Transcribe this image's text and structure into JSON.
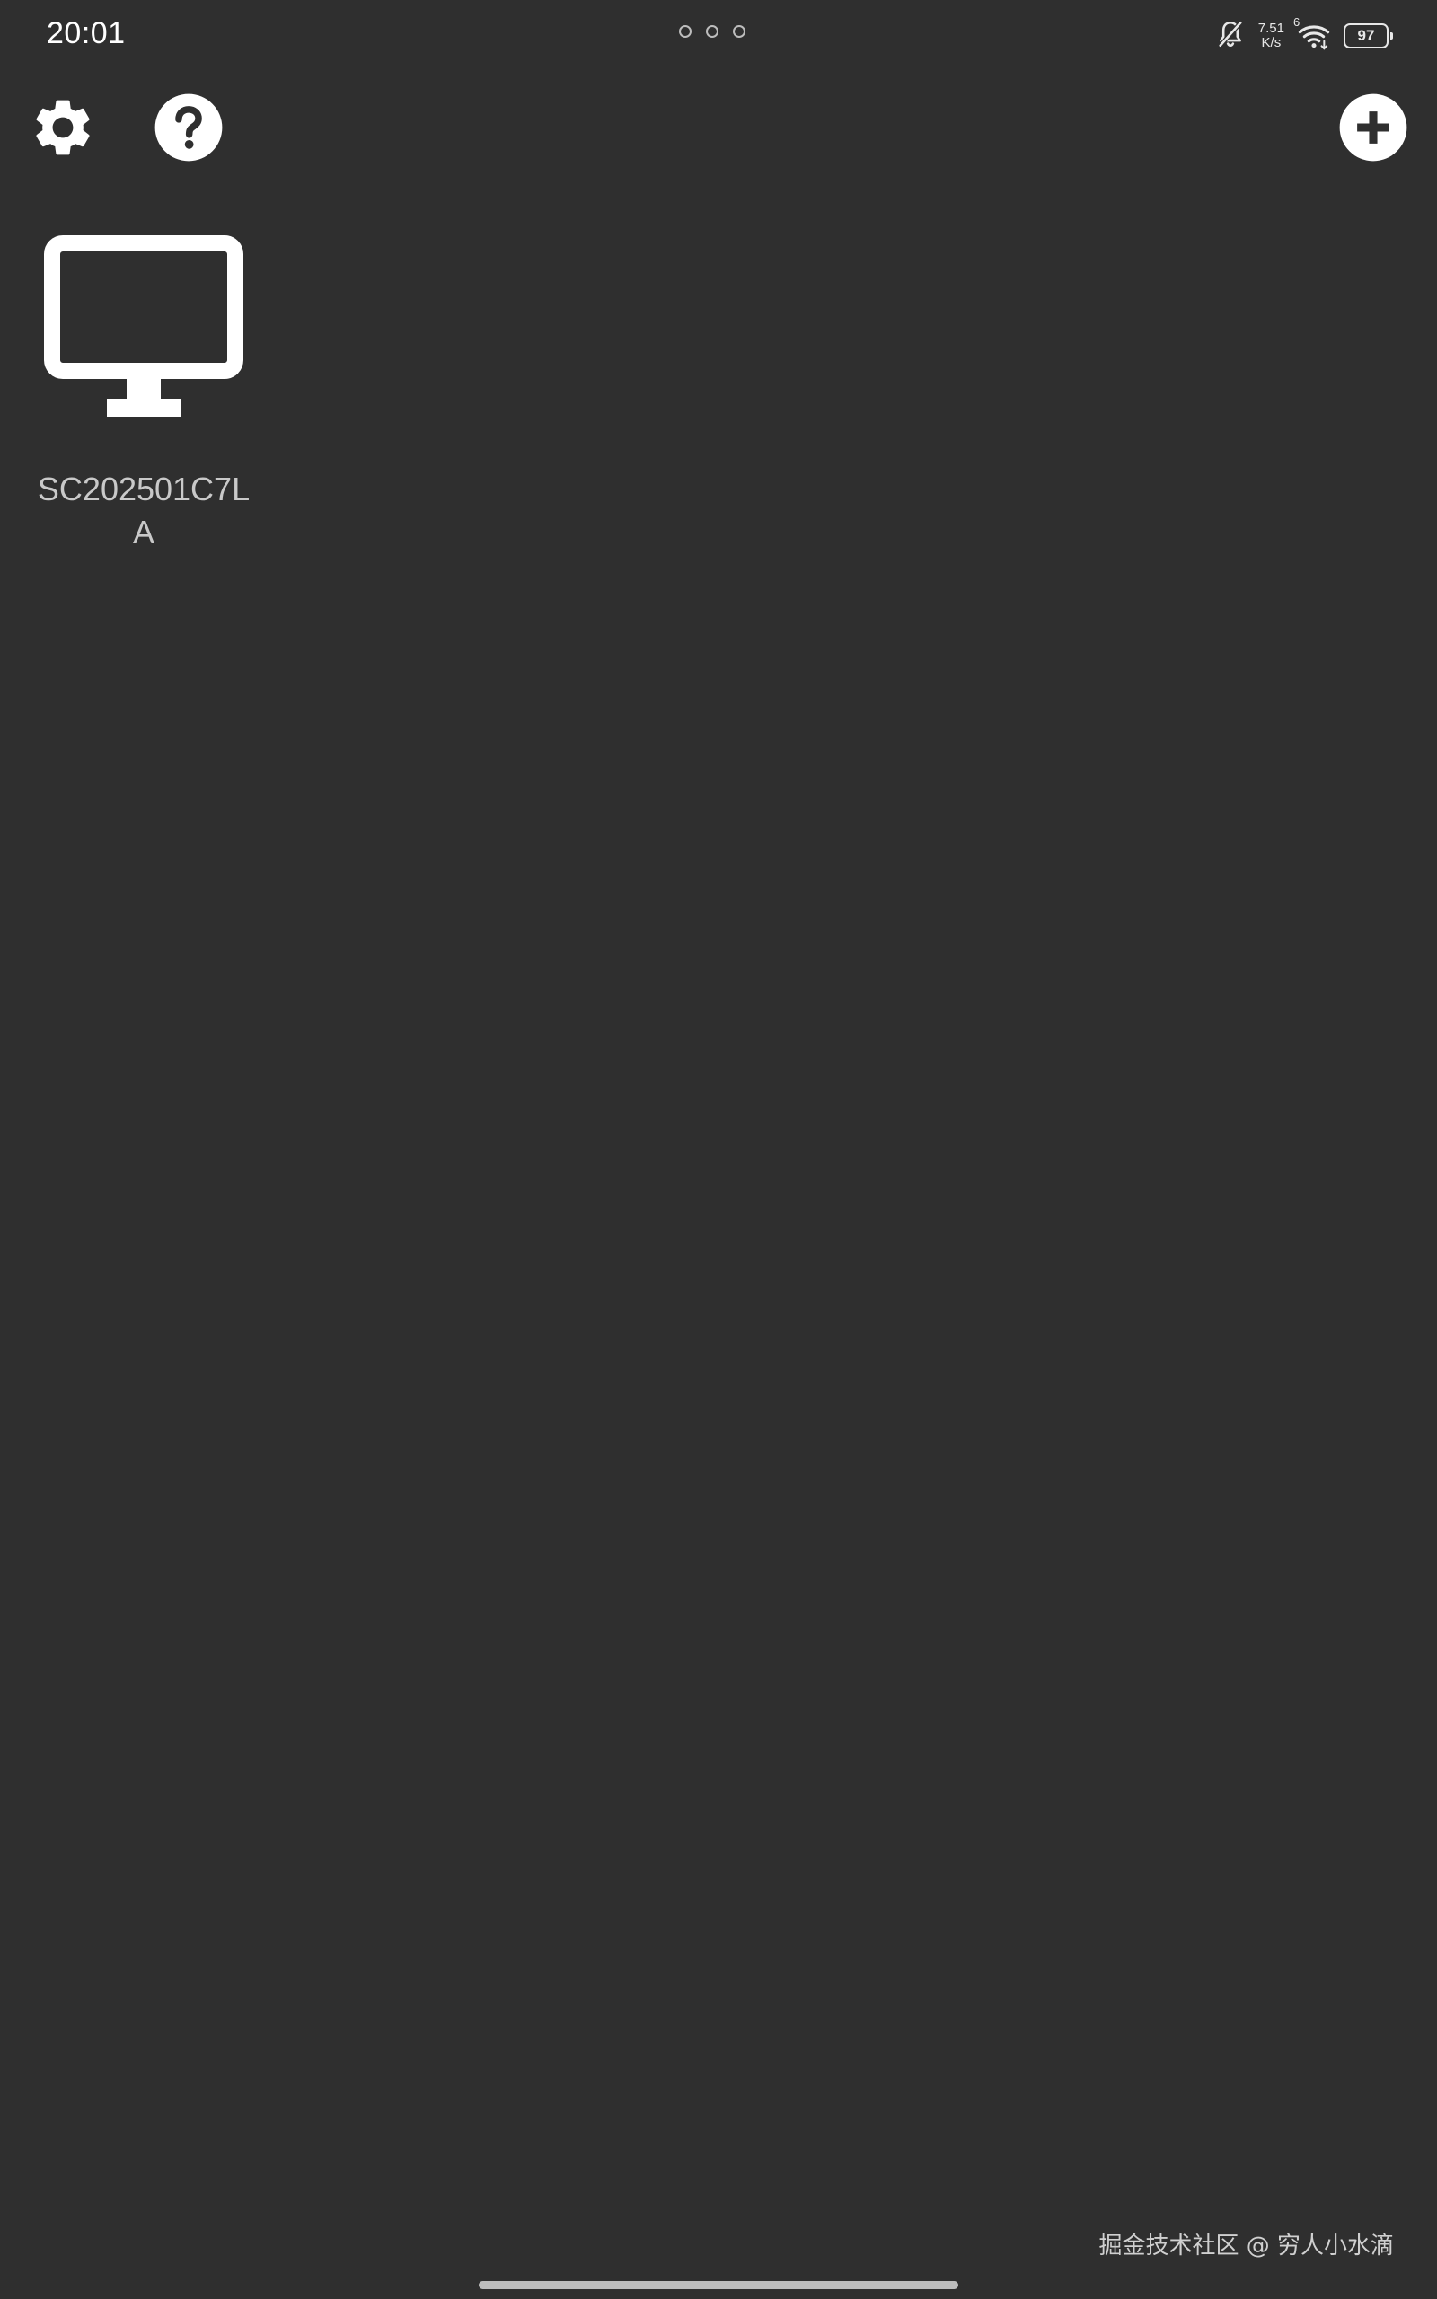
{
  "status_bar": {
    "time": "20:01",
    "net_speed_value": "7.51",
    "net_speed_unit": "K/s",
    "wifi_badge": "6",
    "battery_level": "97",
    "icons": [
      "bell-off-icon",
      "wifi-icon",
      "battery-icon"
    ]
  },
  "toolbar": {
    "icons": [
      "gear-icon",
      "help-icon",
      "add-icon"
    ]
  },
  "devices": [
    {
      "name": "SC202501C7LA",
      "icon": "monitor-icon"
    }
  ],
  "watermark": "掘金技术社区 @ 穷人小水滴",
  "colors": {
    "background": "#2f2f2f",
    "icon": "#ffffff",
    "label": "#c9c9c9"
  }
}
